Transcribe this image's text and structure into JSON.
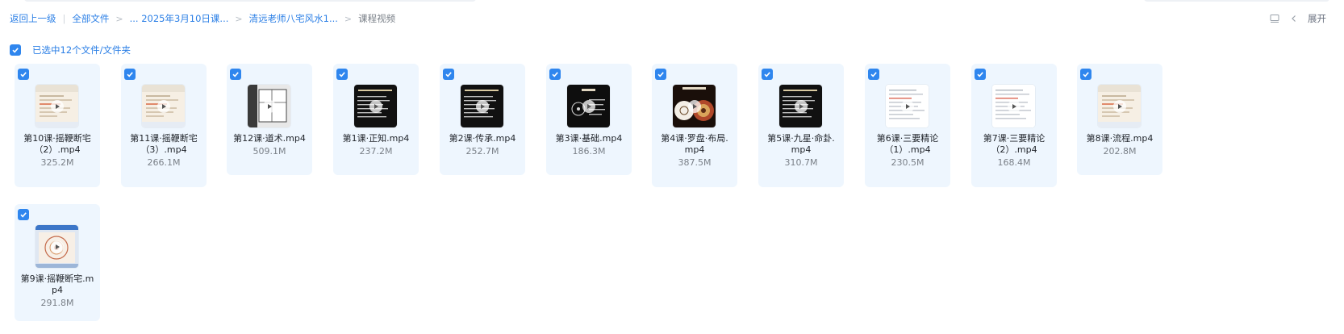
{
  "breadcrumb": {
    "back": "返回上一级",
    "all_files": "全部文件",
    "level1": "... 2025年3月10日课...",
    "level2": "清远老师八宅风水1...",
    "current": "课程视频"
  },
  "toolbar": {
    "expand_label": "展开",
    "list_view_icon": "list-view-icon",
    "collapse_icon": "chevron-left-icon"
  },
  "selection": {
    "label": "已选中12个文件/文件夹",
    "checked": true
  },
  "colors": {
    "accent": "#2f86ee",
    "link": "#2b7fe6",
    "card_bg": "#eef6fe",
    "muted": "#7a8088"
  },
  "files": [
    {
      "name": "第10课·摇鞭断宅（2）.mp4",
      "size": "325.2M",
      "thumb": "doc-light",
      "checked": true
    },
    {
      "name": "第11课·摇鞭断宅（3）.mp4",
      "size": "266.1M",
      "thumb": "doc-light",
      "checked": true
    },
    {
      "name": "第12课·道术.mp4",
      "size": "509.1M",
      "thumb": "floorplan",
      "checked": true
    },
    {
      "name": "第1课·正知.mp4",
      "size": "237.2M",
      "thumb": "dark-text",
      "checked": true
    },
    {
      "name": "第2课·传承.mp4",
      "size": "252.7M",
      "thumb": "dark-text",
      "checked": true
    },
    {
      "name": "第3课·基础.mp4",
      "size": "186.3M",
      "thumb": "dark-diagram",
      "checked": true
    },
    {
      "name": "第4课·罗盘·布局.mp4",
      "size": "387.5M",
      "thumb": "compass",
      "checked": true
    },
    {
      "name": "第5课·九星·命卦.mp4",
      "size": "310.7M",
      "thumb": "dark-text",
      "checked": true
    },
    {
      "name": "第6课·三要精论（1）.mp4",
      "size": "230.5M",
      "thumb": "doc-white",
      "checked": true
    },
    {
      "name": "第7课·三要精论（2）.mp4",
      "size": "168.4M",
      "thumb": "doc-white",
      "checked": true
    },
    {
      "name": "第8课·流程.mp4",
      "size": "202.8M",
      "thumb": "doc-light",
      "checked": true
    },
    {
      "name": "第9课·摇鞭断宅.mp4",
      "size": "291.8M",
      "thumb": "screen-app",
      "checked": true
    }
  ]
}
